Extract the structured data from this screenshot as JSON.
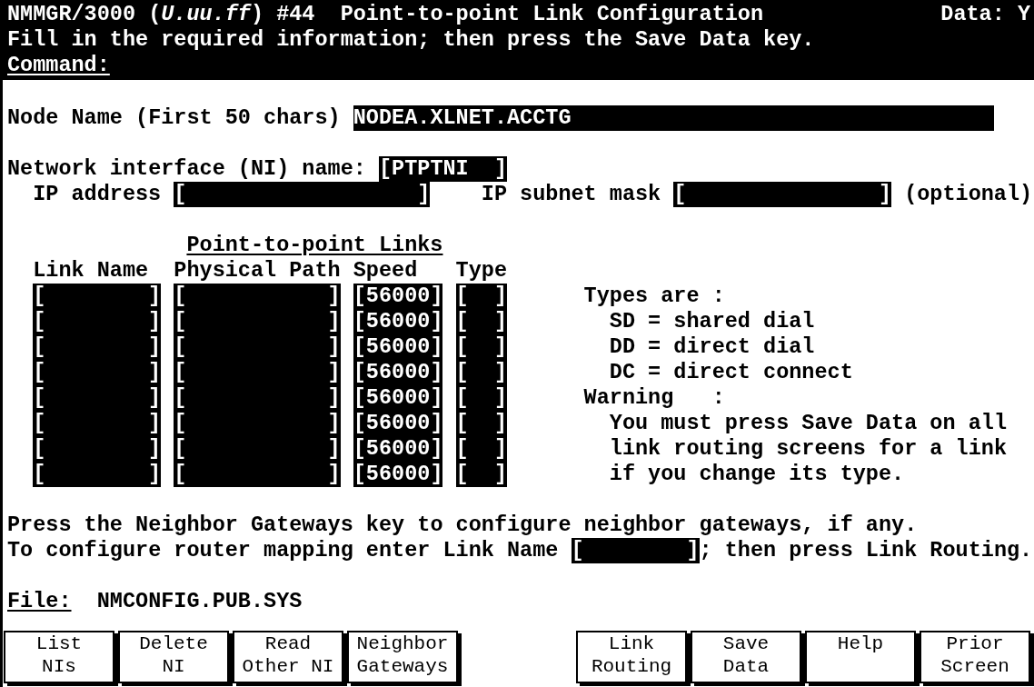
{
  "header": {
    "title": "NMMGR/3000 (*U.uu.ff*) #44  Point-to-point Link Configuration",
    "data_flag": "Data: Y",
    "message": "Fill in the required information; then press the Save Data key.",
    "command_label": "Command:"
  },
  "node_name": {
    "label": "Node Name (First 50 chars)",
    "value": "NODEA.XLNET.ACCTG"
  },
  "ni_name": {
    "label": "Network interface (NI) name:",
    "value": "[PTPTNI  ]"
  },
  "ip_address": {
    "label": "IP address",
    "value": "[                  ]"
  },
  "subnet_mask": {
    "label": "IP subnet mask",
    "value": "[               ]",
    "note": "(optional)"
  },
  "links": {
    "title": "Point-to-point Links",
    "columns": [
      "Link Name",
      "Physical Path",
      "Speed",
      "Type"
    ],
    "rows": [
      {
        "link_name": "[        ]",
        "physical_path": "[           ]",
        "speed": "[56000]",
        "type": "[  ]"
      },
      {
        "link_name": "[        ]",
        "physical_path": "[           ]",
        "speed": "[56000]",
        "type": "[  ]"
      },
      {
        "link_name": "[        ]",
        "physical_path": "[           ]",
        "speed": "[56000]",
        "type": "[  ]"
      },
      {
        "link_name": "[        ]",
        "physical_path": "[           ]",
        "speed": "[56000]",
        "type": "[  ]"
      },
      {
        "link_name": "[        ]",
        "physical_path": "[           ]",
        "speed": "[56000]",
        "type": "[  ]"
      },
      {
        "link_name": "[        ]",
        "physical_path": "[           ]",
        "speed": "[56000]",
        "type": "[  ]"
      },
      {
        "link_name": "[        ]",
        "physical_path": "[           ]",
        "speed": "[56000]",
        "type": "[  ]"
      },
      {
        "link_name": "[        ]",
        "physical_path": "[           ]",
        "speed": "[56000]",
        "type": "[  ]"
      }
    ]
  },
  "help_notes": [
    {
      "kind": "heading",
      "text": "Types are :"
    },
    {
      "kind": "item",
      "text": "SD = shared dial"
    },
    {
      "kind": "item",
      "text": "DD = direct dial"
    },
    {
      "kind": "item",
      "text": "DC = direct connect"
    },
    {
      "kind": "heading",
      "text": "Warning   :"
    },
    {
      "kind": "item",
      "text": "You must press Save Data on all"
    },
    {
      "kind": "item",
      "text": "link routing screens for a link"
    },
    {
      "kind": "item",
      "text": "if you change its type."
    }
  ],
  "instructions": {
    "neighbor": "Press the Neighbor Gateways key to configure neighbor gateways, if any.",
    "routing_before": "To configure router mapping enter Link Name",
    "routing_field": "[        ]",
    "routing_after": "; then press Link Routing."
  },
  "file": {
    "label": "File:",
    "value": "NMCONFIG.PUB.SYS"
  },
  "softkeys": [
    {
      "kind": "key",
      "lines": [
        "List",
        "NIs"
      ]
    },
    {
      "kind": "key",
      "lines": [
        "Delete",
        "NI"
      ]
    },
    {
      "kind": "key",
      "lines": [
        "Read",
        "Other NI"
      ]
    },
    {
      "kind": "key",
      "lines": [
        "Neighbor",
        "Gateways"
      ]
    },
    {
      "kind": "blank"
    },
    {
      "kind": "key",
      "lines": [
        "Link",
        "Routing"
      ]
    },
    {
      "kind": "key",
      "lines": [
        "Save",
        "Data"
      ]
    },
    {
      "kind": "key",
      "lines": [
        "Help"
      ]
    },
    {
      "kind": "key",
      "lines": [
        "Prior",
        "Screen"
      ]
    }
  ]
}
